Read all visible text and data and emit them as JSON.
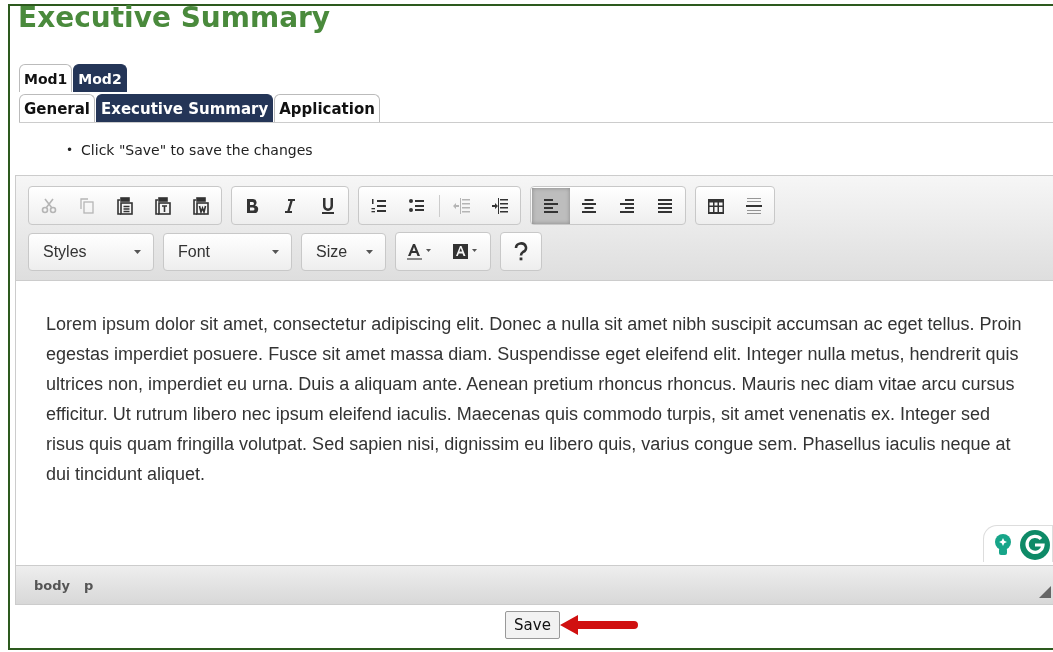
{
  "page": {
    "title": "Executive Summary"
  },
  "module_tabs": [
    {
      "label": "Mod1",
      "selected": false
    },
    {
      "label": "Mod2",
      "selected": true
    }
  ],
  "section_tabs": [
    {
      "label": "General",
      "selected": false
    },
    {
      "label": "Executive Summary",
      "selected": true
    },
    {
      "label": "Application",
      "selected": false
    }
  ],
  "instructions": [
    {
      "marker": "•",
      "text": "Click \"Save\" to save the changes"
    }
  ],
  "editor": {
    "toolbar_groups": [
      [
        {
          "disabled": true,
          "selected": false
        },
        {
          "disabled": true,
          "selected": false
        },
        {
          "disabled": false,
          "selected": false
        },
        {
          "disabled": false,
          "selected": false
        },
        {
          "disabled": false,
          "selected": false
        }
      ],
      [
        {
          "disabled": false,
          "selected": false
        },
        {
          "disabled": false,
          "selected": false
        },
        {
          "disabled": false,
          "selected": false
        }
      ],
      [
        {
          "disabled": false,
          "selected": false
        },
        {
          "disabled": false,
          "selected": false
        },
        {
          "disabled": true,
          "selected": false
        },
        {
          "disabled": false,
          "selected": false
        }
      ],
      [
        {
          "disabled": false,
          "selected": true
        },
        {
          "disabled": false,
          "selected": false
        },
        {
          "disabled": false,
          "selected": false
        },
        {
          "disabled": false,
          "selected": false
        }
      ],
      [
        {
          "disabled": false,
          "selected": false
        },
        {
          "disabled": false,
          "selected": false
        }
      ]
    ],
    "dropdowns": [
      {
        "label": "Styles"
      },
      {
        "label": "Font"
      },
      {
        "label": "Size"
      }
    ],
    "content": "Lorem ipsum dolor sit amet, consectetur adipiscing elit. Donec a nulla sit amet nibh suscipit accumsan ac eget tellus. Proin egestas imperdiet posuere. Fusce sit amet massa diam. Suspendisse eget eleifend elit. Integer nulla metus, hendrerit quis ultrices non, imperdiet eu urna. Duis a aliquam ante. Aenean pretium rhoncus rhoncus. Mauris nec diam vitae arcu cursus efficitur. Ut rutrum libero nec ipsum eleifend iaculis. Maecenas quis commodo turpis, sit amet venenatis ex. Integer sed risus quis quam fringilla volutpat. Sed sapien nisi, dignissim eu libero quis, varius congue sem. Phasellus iaculis neque at dui tincidunt aliquet.",
    "path": [
      "body",
      "p"
    ]
  },
  "save_button": "Save"
}
